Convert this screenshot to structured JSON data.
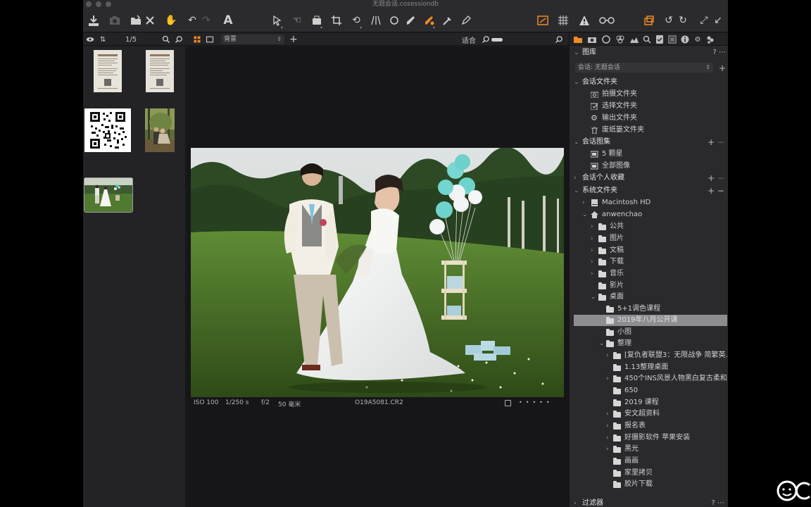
{
  "window": {
    "title": "无题会话.cosessiondb"
  },
  "toolbar": {
    "left_icons": [
      "import-icon",
      "camera-icon",
      "folder-move-icon",
      "close-icon",
      "hand-icon",
      "undo-icon",
      "redo-icon",
      "text-icon"
    ],
    "center_icons": [
      "cursor-icon",
      "pan-icon",
      "loupe-icon",
      "crop-icon",
      "rotate-icon",
      "keystone-icon",
      "spot-icon",
      "brush-icon",
      "eraser-icon",
      "gradient-icon",
      "pick-color-icon"
    ],
    "right_icons": [
      "exposure-warning-icon",
      "grid-icon",
      "warning-icon",
      "glasses-icon",
      "copy-adjustments-icon",
      "rotate-left-icon",
      "rotate-right-icon",
      "expand-icon",
      "collapse-icon"
    ]
  },
  "browser": {
    "counter": "1/5",
    "filter_value": "背景",
    "fit_label": "适合"
  },
  "thumbnails": [
    {
      "name": "document-thumb-1",
      "selected": false
    },
    {
      "name": "document-thumb-2",
      "selected": false
    },
    {
      "name": "qr-code-thumb",
      "selected": false
    },
    {
      "name": "couple-forest-thumb",
      "selected": false
    },
    {
      "name": "wedding-lawn-thumb",
      "selected": true
    }
  ],
  "viewer": {
    "iso": "ISO 100",
    "shutter": "1/250 s",
    "aperture": "f/2",
    "focal": "50 毫米",
    "filename": "O19A5081.CR2"
  },
  "panel": {
    "library_title": "图库",
    "session_select": "会话: 无题会话",
    "session_folders": {
      "title": "会话文件夹",
      "items": [
        "拍摄文件夹",
        "选择文件夹",
        "输出文件夹",
        "废纸篓文件夹"
      ]
    },
    "session_albums": {
      "title": "会话图集",
      "items": [
        "5 颗星",
        "全部图像"
      ]
    },
    "favorites": {
      "title": "会话个人收藏"
    },
    "system_folders": {
      "title": "系统文件夹",
      "drive": "Macintosh HD",
      "user": "anwenchao",
      "user_folders": [
        "公共",
        "图片",
        "文稿",
        "下载",
        "音乐",
        "影片",
        "桌面"
      ],
      "desktop_folders": [
        "5+1调色课程",
        "2019年八月公开课",
        "小图",
        "整理"
      ],
      "zhengli_folders": [
        "[复仇者联盟3：无限战争 简繁英...",
        "1.13整理桌面",
        "450个INS风景人物黑白复古柔和...",
        "650",
        "2019 课程",
        "安文超资料",
        "报名表",
        "好摄影软件 苹果安装",
        "黑光",
        "画画",
        "家里拷贝",
        "胶片下载"
      ]
    },
    "filters_title": "过滤器"
  },
  "colors": {
    "accent": "#f08a24",
    "selected_row": "#8d8d90"
  }
}
